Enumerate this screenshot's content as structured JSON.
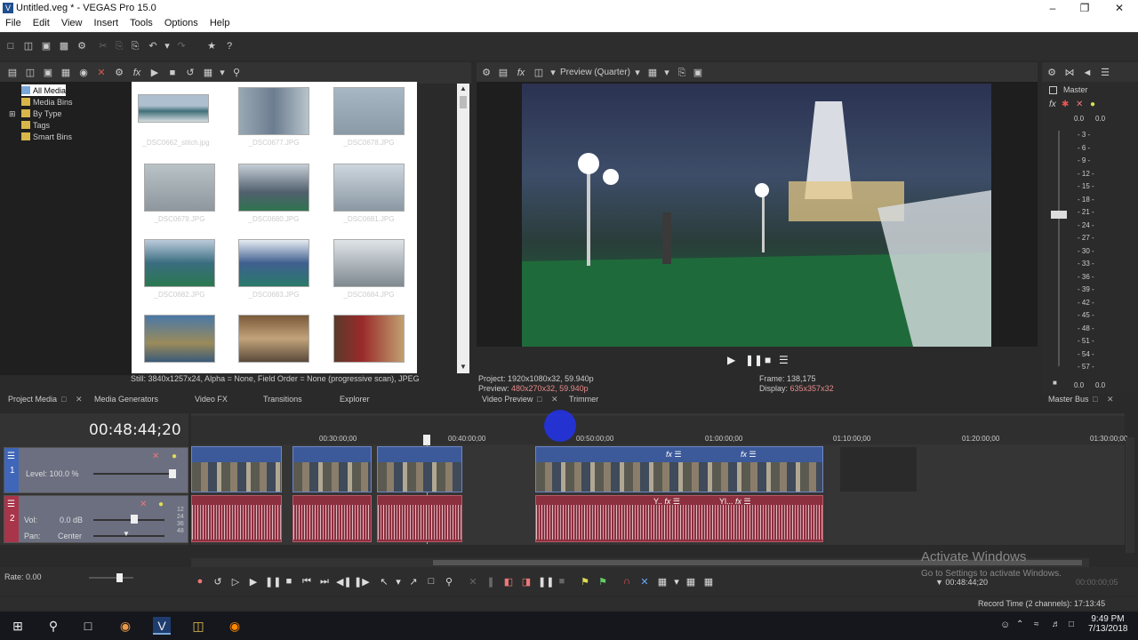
{
  "window": {
    "title": "Untitled.veg * - VEGAS Pro 15.0",
    "icon": "V"
  },
  "menubar": [
    "File",
    "Edit",
    "View",
    "Insert",
    "Tools",
    "Options",
    "Help"
  ],
  "explorer_tree": [
    "All Media",
    "Media Bins",
    "By Type",
    "Tags",
    "Smart Bins"
  ],
  "media": [
    {
      "name": "_DSC0662_stitch.jpg"
    },
    {
      "name": "_DSC0677.JPG"
    },
    {
      "name": "_DSC0678.JPG"
    },
    {
      "name": "_DSC0679.JPG"
    },
    {
      "name": "_DSC0680.JPG"
    },
    {
      "name": "_DSC0681.JPG"
    },
    {
      "name": "_DSC0682.JPG"
    },
    {
      "name": "_DSC0683.JPG"
    },
    {
      "name": "_DSC0684.JPG"
    },
    {
      "name": ""
    },
    {
      "name": ""
    },
    {
      "name": ""
    }
  ],
  "media_status": "Still: 3840x1257x24, Alpha = None, Field Order = None (progressive scan), JPEG",
  "left_tabs": [
    "Project Media",
    "Media Generators",
    "Video FX",
    "Transitions",
    "Explorer"
  ],
  "preview": {
    "mode": "Preview (Quarter)",
    "project_label": "Project:",
    "project_value": "1920x1080x32, 59.940p",
    "preview_label": "Preview:",
    "preview_value": "480x270x32, 59.940p",
    "frame_label": "Frame:",
    "frame_value": "138,175",
    "display_label": "Display:",
    "display_value": "635x357x32",
    "tabs": [
      "Video Preview",
      "Trimmer"
    ]
  },
  "master": {
    "title": "Master",
    "tab": "Master Bus",
    "scale": [
      "3",
      "6",
      "9",
      "12",
      "15",
      "18",
      "21",
      "24",
      "27",
      "30",
      "33",
      "36",
      "39",
      "42",
      "45",
      "48",
      "51",
      "54",
      "57"
    ],
    "bottom_left": "0.0",
    "bottom_right": "0.0",
    "top_left": "0.0",
    "top_right": "0.0"
  },
  "timeline": {
    "timecode": "00:48:44;20",
    "ruler": [
      "00:30:00;00",
      "00:40:00;00",
      "00:50:00;00",
      "01:00:00;00",
      "01:10:00;00",
      "01:20:00;00",
      "01:30:00;00"
    ],
    "track1": {
      "num": "1",
      "level": "Level: 100.0 %"
    },
    "track2": {
      "num": "2",
      "vol_label": "Vol:",
      "vol_value": "0.0 dB",
      "pan_label": "Pan:",
      "pan_value": "Center"
    },
    "meter_labels": [
      "12",
      "24",
      "36",
      "48"
    ]
  },
  "transport": {
    "rate": "Rate: 0.00",
    "cursor_time": "00:48:44;20",
    "end_time": "00:00:00;05"
  },
  "status": {
    "record_time": "Record Time (2 channels): 17:13:45"
  },
  "watermark": {
    "line1": "Activate Windows",
    "line2": "Go to Settings to activate Windows."
  },
  "taskbar": {
    "time": "9:49 PM",
    "date": "7/13/2018"
  },
  "colors": {
    "accent": "#3c5a9a",
    "audio": "#8c2f3e",
    "bg": "#2a2a2a"
  }
}
